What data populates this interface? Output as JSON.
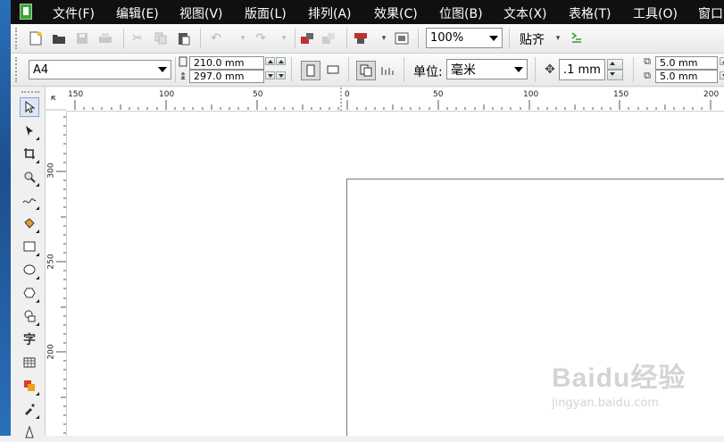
{
  "menu": {
    "items": [
      "文件(F)",
      "编辑(E)",
      "视图(V)",
      "版面(L)",
      "排列(A)",
      "效果(C)",
      "位图(B)",
      "文本(X)",
      "表格(T)",
      "工具(O)",
      "窗口"
    ]
  },
  "toolbar1": {
    "icons": [
      "new-icon",
      "open-icon",
      "save-icon",
      "print-icon",
      "cut-icon",
      "copy-icon",
      "paste-icon",
      "undo-icon",
      "redo-icon",
      "import-icon",
      "export-icon",
      "publish-icon",
      "app-launcher-icon"
    ],
    "zoom": "100%",
    "snap_label": "贴齐"
  },
  "toolbar2": {
    "paper_size": "A4",
    "width": "210.0 mm",
    "height": "297.0 mm",
    "units_label": "单位:",
    "units_value": "毫米",
    "nudge": ".1 mm",
    "dup_x": "5.0 mm",
    "dup_y": "5.0 mm"
  },
  "rulers": {
    "horizontal": [
      "150",
      "100",
      "50",
      "0",
      "50",
      "100",
      "150",
      "200"
    ],
    "vertical": [
      "300",
      "250",
      "200"
    ]
  },
  "tools": [
    "pick-tool-icon",
    "shape-tool-icon",
    "crop-tool-icon",
    "zoom-tool-icon",
    "freehand-tool-icon",
    "smart-fill-icon",
    "rectangle-tool-icon",
    "ellipse-tool-icon",
    "polygon-tool-icon",
    "basic-shapes-icon",
    "text-tool-icon",
    "table-tool-icon",
    "interactive-tool-icon",
    "eyedropper-tool-icon",
    "outline-tool-icon"
  ],
  "text_tool_glyph": "字",
  "watermark": {
    "logo": "Baidu经验",
    "url": "jingyan.baidu.com"
  }
}
